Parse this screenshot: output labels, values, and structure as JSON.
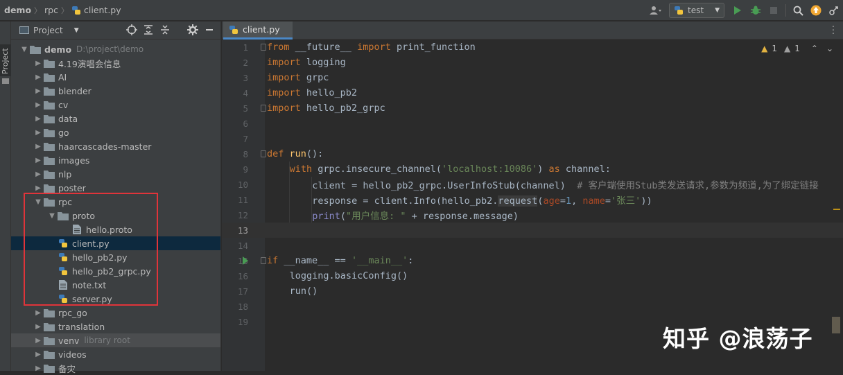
{
  "titlebar": {
    "crumbs": [
      "demo",
      "rpc",
      "client.py"
    ],
    "run_config": "test"
  },
  "sidebar_stripe": {
    "label": "Project"
  },
  "project_panel": {
    "title": "Project",
    "tree": [
      {
        "label": "demo",
        "extra": "D:\\project\\demo",
        "type": "folder",
        "level": 0,
        "expanded": true
      },
      {
        "label": "4.19演唱会信息",
        "type": "folder",
        "level": 1
      },
      {
        "label": "AI",
        "type": "folder",
        "level": 1
      },
      {
        "label": "blender",
        "type": "folder",
        "level": 1
      },
      {
        "label": "cv",
        "type": "folder",
        "level": 1
      },
      {
        "label": "data",
        "type": "folder",
        "level": 1
      },
      {
        "label": "go",
        "type": "folder",
        "level": 1
      },
      {
        "label": "haarcascades-master",
        "type": "folder",
        "level": 1
      },
      {
        "label": "images",
        "type": "folder",
        "level": 1
      },
      {
        "label": "nlp",
        "type": "folder",
        "level": 1
      },
      {
        "label": "poster",
        "type": "folder",
        "level": 1
      },
      {
        "label": "rpc",
        "type": "folder",
        "level": 1,
        "expanded": true
      },
      {
        "label": "proto",
        "type": "folder",
        "level": 2,
        "expanded": true
      },
      {
        "label": "hello.proto",
        "type": "file",
        "level": 3
      },
      {
        "label": "client.py",
        "type": "python",
        "level": 2,
        "selected": true
      },
      {
        "label": "hello_pb2.py",
        "type": "python",
        "level": 2
      },
      {
        "label": "hello_pb2_grpc.py",
        "type": "python",
        "level": 2
      },
      {
        "label": "note.txt",
        "type": "file",
        "level": 2
      },
      {
        "label": "server.py",
        "type": "python",
        "level": 2
      },
      {
        "label": "rpc_go",
        "type": "folder",
        "level": 1
      },
      {
        "label": "translation",
        "type": "folder",
        "level": 1
      },
      {
        "label": "venv",
        "extra": "library root",
        "type": "folder",
        "level": 1,
        "hover": true
      },
      {
        "label": "videos",
        "type": "folder",
        "level": 1
      },
      {
        "label": "备灾",
        "type": "folder",
        "level": 1
      }
    ]
  },
  "editor": {
    "tab_label": "client.py",
    "warnings": {
      "warn_count": "1",
      "weak_count": "1"
    },
    "line_numbers": [
      "1",
      "2",
      "3",
      "4",
      "5",
      "6",
      "7",
      "8",
      "9",
      "10",
      "11",
      "12",
      "13",
      "14",
      "15",
      "16",
      "17",
      "18",
      "19"
    ],
    "current_line": "13",
    "tokens": {
      "l1": [
        "from",
        " __future__ ",
        "import",
        " print_function"
      ],
      "l2": [
        "import",
        " logging"
      ],
      "l3": [
        "import",
        " grpc"
      ],
      "l4": [
        "import",
        " hello_pb2"
      ],
      "l5": [
        "import",
        " hello_pb2_grpc"
      ],
      "l8": [
        "def",
        " ",
        "run",
        "():"
      ],
      "l9": [
        "with",
        " grpc.insecure_channel(",
        "'localhost:10086'",
        ") ",
        "as",
        " channel:"
      ],
      "l10": [
        "client = hello_pb2_grpc.UserInfoStub(channel)  ",
        "# 客户端使用Stub类发送请求,参数为频道,为了绑定链接"
      ],
      "l11": [
        "response = client.Info(hello_pb2.",
        "request",
        "(",
        "age",
        "=",
        "1",
        ", ",
        "name",
        "=",
        "'张三'",
        "))"
      ],
      "l12": [
        "print",
        "(",
        "\"用户信息: \"",
        " + response.message)"
      ],
      "l15": [
        "if",
        " __name__ == ",
        "'__main__'",
        ":"
      ],
      "l16": [
        "logging.basicConfig()"
      ],
      "l17": [
        "run()"
      ]
    }
  },
  "watermark": "知乎 @浪荡子",
  "colors": {
    "accent": "#4a88c7",
    "selection": "#0d293e",
    "highlight_box": "#e0343a"
  }
}
